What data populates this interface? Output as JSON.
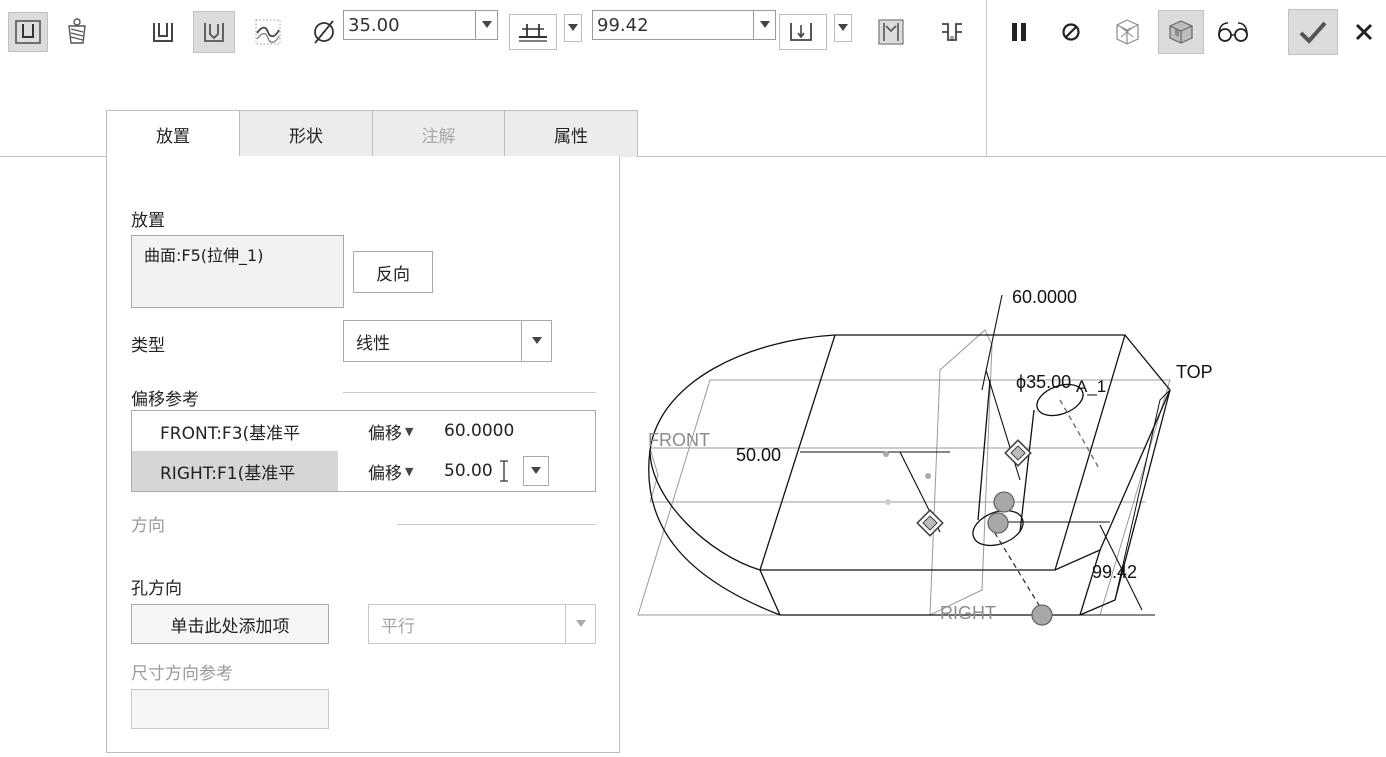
{
  "toolbar": {
    "diameter_value": "35.00",
    "depth_value": "99.42"
  },
  "tabs": {
    "placement": "放置",
    "shape": "形状",
    "notes": "注解",
    "properties": "属性"
  },
  "panel": {
    "placement_label": "放置",
    "placement_ref": "曲面:F5(拉伸_1)",
    "flip_button": "反向",
    "type_label": "类型",
    "type_value": "线性",
    "offset_refs_label": "偏移参考",
    "offset_refs": [
      {
        "ref": "FRONT:F3(基准平",
        "type": "偏移",
        "value": "60.0000"
      },
      {
        "ref": "RIGHT:F1(基准平",
        "type": "偏移",
        "value": "50.00"
      }
    ],
    "direction_label": "方向",
    "hole_direction_label": "孔方向",
    "hole_direction_button": "单击此处添加项",
    "hole_direction_value": "平行",
    "dim_direction_ref_label": "尺寸方向参考"
  },
  "graphics": {
    "dim_front_offset": "60.0000",
    "dim_diameter": "ϕ35.00",
    "dim_right_offset": "50.00",
    "dim_depth": "99.42",
    "datum_front": "FRONT",
    "datum_top": "TOP",
    "datum_right": "RIGHT",
    "axis_label": "A_1"
  },
  "colors": {
    "active_button_bg": "#dcdcdc",
    "handle_gray": "#a8a8a8",
    "datum_gray": "#8c8c8c"
  }
}
